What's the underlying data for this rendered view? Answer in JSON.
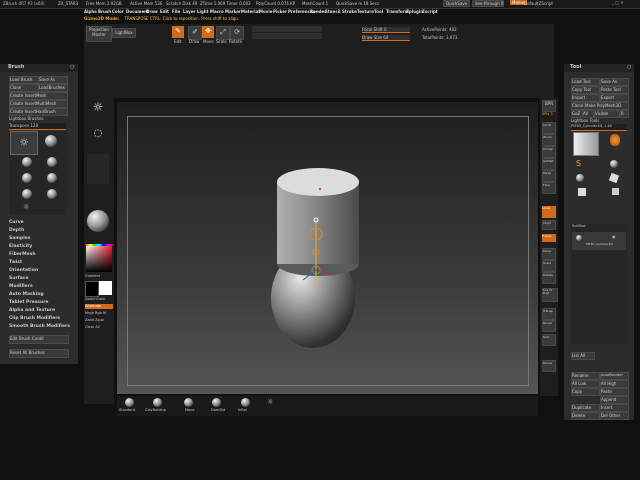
{
  "titlebar": {
    "app": "ZBrush 4R7 P3 (x64)",
    "items": [
      "ZX_STAR3",
      "Free Mem 2.92GB",
      "Active Mem 536",
      "Scratch Disk 49",
      "ZTime 1.069 Timer 0.002",
      "PolyCount 0.074 KP",
      "MeshCount 1",
      "QuickSave In 19 Secs"
    ],
    "right": [
      "QuickSave",
      "See-through 0",
      "Menus",
      "DefaultZScript"
    ]
  },
  "menubar": [
    "Alpha",
    "Brush",
    "Color",
    "Document",
    "Draw",
    "Edit",
    "File",
    "Layer",
    "Light",
    "Macro",
    "Marker",
    "Material",
    "Movie",
    "Picker",
    "Preferences",
    "Render",
    "Stencil",
    "Stroke",
    "Texture",
    "Tool",
    "Transform",
    "Zplugin",
    "Zscript"
  ],
  "hint": {
    "prefix": "Gizmo3D Mode:",
    "text": "TRANSPOSE CTRL: Click to reposition. Press shift to align."
  },
  "top_toolbar": {
    "projection": "Projection Master",
    "lightbox": "LightBox",
    "buttons": [
      "Edit",
      "Draw",
      "Move",
      "Scale",
      "Rotate"
    ],
    "focal_shift": "Focal Shift 0",
    "draw_size": "Draw Size 64",
    "active_points": "ActivePoints: 482",
    "total_points": "TotalPoints: 3,073"
  },
  "left_panel": {
    "header": "Brush",
    "buttons": [
      [
        "Load Brush",
        "Save As"
      ],
      [
        "Clone",
        "LoadBrushes"
      ],
      [
        "Create InsertMesh"
      ],
      [
        "Create InsertMultiMesh"
      ],
      [
        "Create InsertHairBrush"
      ]
    ],
    "lightbox": "Lightbox Brushes",
    "transpose": "Transpose 128",
    "sections": [
      "Curve",
      "Depth",
      "Samples",
      "Elasticity",
      "FiberMesh",
      "Twist",
      "Orientation",
      "Surface",
      "Modifiers",
      "Auto Masking",
      "Tablet Pressure",
      "Alpha and Texture",
      "Clip Brush Modifiers",
      "Smooth Brush Modifiers"
    ],
    "bottom_buttons": [
      "Edit Brush Credit",
      "Reset All Brushes"
    ]
  },
  "left_strip": {
    "labels": [
      "Gradient",
      "SwitchColor",
      "Alternate",
      "Mrgb Rgb M",
      "Zadd Zsub",
      "Clear All"
    ]
  },
  "right_shelf": {
    "buttons": [
      "BPR",
      "SPix 3",
      "Scroll",
      "Zoom",
      "Actual",
      "AAHalf",
      "Persp",
      "Floor",
      "Local",
      "LSym",
      "Frame",
      "Move",
      "Scale",
      "Rotate",
      "Line Fill PolyF",
      "Transp",
      "Ghost",
      "Solo",
      "Xpose"
    ]
  },
  "tool_panel": {
    "header": "Tool",
    "buttons": [
      [
        "Load Tool",
        "Save As"
      ],
      [
        "Copy Tool",
        "Paste Tool"
      ],
      [
        "Import",
        "Export"
      ],
      [
        "Clone",
        "Make PolyMesh3D"
      ],
      [
        "GoZ",
        "All",
        "Visible",
        "R"
      ]
    ],
    "lightbox": "Lightbox Tools",
    "current": "PM3D_Cylinder3D_1 48",
    "thumbs": [
      "PM3D_Cylinder3D",
      "SimpleBrush",
      "Cylinder3D",
      "Sphere3D",
      "Cube3D"
    ],
    "subtool_label": "SubTool",
    "subtool_item": "PM3D_Cylinder3D",
    "list_all": "List All",
    "bottom_buttons": [
      [
        "Rename",
        "AutoReorder"
      ],
      [
        "All Low",
        "All High"
      ],
      [
        "Copy",
        "Paste"
      ],
      [
        "Append"
      ],
      [
        "Duplicate",
        "Insert"
      ],
      [
        "Delete",
        "Del Other"
      ],
      [
        "Del All"
      ]
    ]
  },
  "bottom_shelf": {
    "brushes": [
      "Standard",
      "ClayBuildup",
      "Move",
      "DamStd",
      "Inflat",
      "hPolish"
    ]
  },
  "scene": {
    "subject": "cylinder-on-sphere"
  },
  "colors": {
    "accent": "#d26a1a",
    "panel_bg": "#2c2c2c",
    "canvas_bg": "#3a3a3a"
  }
}
